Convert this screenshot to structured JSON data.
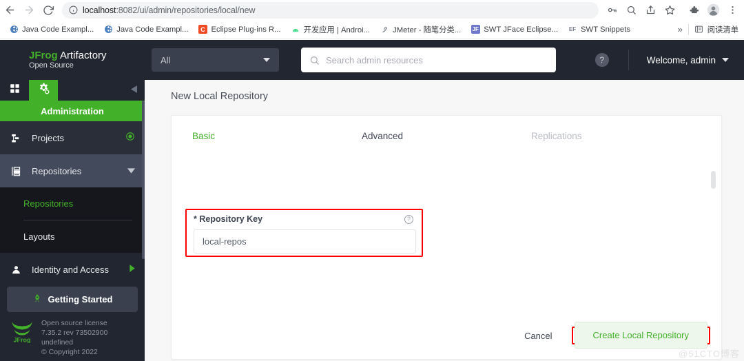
{
  "browser": {
    "nav": {
      "back_icon": "arrow-left-icon",
      "forward_icon": "arrow-right-icon",
      "reload_icon": "reload-icon"
    },
    "omnibox": {
      "info_icon": "site-info-icon",
      "url_host": "localhost",
      "url_path": ":8082/ui/admin/repositories/local/new",
      "url_full": "localhost:8082/ui/admin/repositories/local/new"
    },
    "toolbar_icons": [
      "key-icon",
      "search-icon",
      "share-icon",
      "star-icon",
      "extensions-puzzle-icon",
      "profile-avatar-icon",
      "three-dot-menu-icon"
    ],
    "bookmarks": [
      {
        "label": "Java Code Exampl...",
        "icon": "globe-icon"
      },
      {
        "label": "Java Code Exampl...",
        "icon": "globe-icon"
      },
      {
        "label": "Eclipse Plug-ins R...",
        "icon": "letter-c-icon"
      },
      {
        "label": "开发应用 | Androi...",
        "icon": "android-icon"
      },
      {
        "label": "JMeter - 随笔分类...",
        "icon": "jmeter-icon"
      },
      {
        "label": "SWT JFace Eclipse...",
        "icon": "letter-jf-icon"
      },
      {
        "label": "SWT Snippets",
        "icon": "letter-ef-icon"
      }
    ],
    "overflow_label": "»",
    "reading_list": {
      "label": "阅读清单",
      "icon": "reading-list-icon"
    }
  },
  "app": {
    "logo": {
      "brand": "JFrog",
      "product": "Artifactory",
      "edition": "Open Source"
    },
    "scope_select": {
      "value": "All",
      "icon": "chevron-down-icon"
    },
    "search": {
      "placeholder": "Search admin resources",
      "value": "",
      "icon": "search-icon"
    },
    "help": {
      "label": "?",
      "icon": "help-icon"
    },
    "user_menu": {
      "label": "Welcome, admin",
      "icon": "chevron-down-icon"
    }
  },
  "sidebar": {
    "tabs": [
      {
        "name": "dashboard",
        "icon": "grid-icon",
        "active": false
      },
      {
        "name": "administration",
        "icon": "gear-icon",
        "active": true
      }
    ],
    "collapse_icon": "chevron-left-icon",
    "section_title": "Administration",
    "items": [
      {
        "label": "Projects",
        "icon": "projects-icon",
        "trailing_icon": "target-dot-icon"
      },
      {
        "label": "Repositories",
        "icon": "repositories-icon",
        "trailing_icon": "chevron-down-icon"
      },
      {
        "label": "Identity and Access",
        "icon": "user-icon",
        "trailing_icon": "chevron-right-icon"
      }
    ],
    "submenu": [
      {
        "label": "Repositories",
        "active": true
      },
      {
        "label": "Layouts",
        "active": false
      }
    ],
    "footer": {
      "getting_started": {
        "label": "Getting Started",
        "icon": "rocket-icon"
      },
      "logo_icon": "jfrog-frog-logo",
      "license_lines": [
        "Open source license",
        "7.35.2 rev 73502900",
        "undefined",
        "© Copyright 2022"
      ]
    }
  },
  "main": {
    "page_title": "New Local Repository",
    "tabs": [
      {
        "label": "Basic",
        "state": "active"
      },
      {
        "label": "Advanced",
        "state": "normal"
      },
      {
        "label": "Replications",
        "state": "disabled"
      }
    ],
    "ghost_text": "····· ···",
    "repository_key_field": {
      "required_mark": "*",
      "label": "Repository Key",
      "help_icon": "question-circle-icon",
      "value": "local-repos",
      "placeholder": "local-repos"
    },
    "actions": {
      "cancel_label": "Cancel",
      "create_label": "Create Local Repository"
    }
  },
  "annotations": {
    "highlight_color": "#ff0000",
    "watermark": "@51CTO博客"
  },
  "colors": {
    "brand_green": "#43b02a",
    "topbar_dark": "#222630",
    "sidebar_dark": "#222630",
    "submenu_dark": "#15171d",
    "page_bg": "#f7f7f8"
  }
}
